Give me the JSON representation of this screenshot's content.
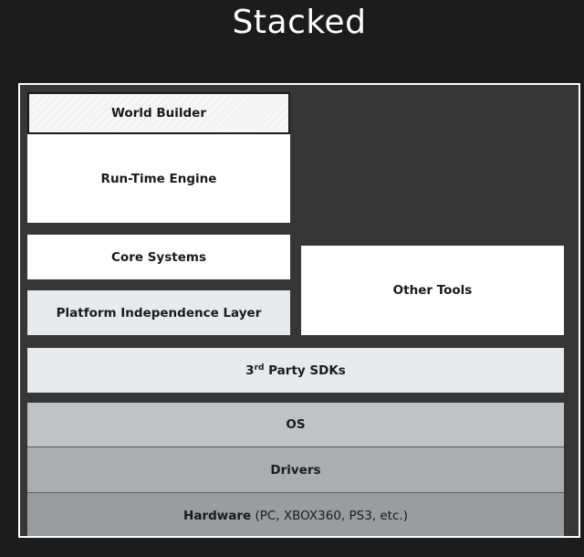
{
  "title": "Stacked",
  "layers": {
    "world_builder": "World Builder",
    "run_time_engine": "Run-Time Engine",
    "core_systems": "Core Systems",
    "platform_independence": "Platform Independence Layer",
    "other_tools": "Other Tools",
    "third_party_sdks": {
      "prefix": "3",
      "superscript": "rd",
      "suffix": " Party SDKs"
    },
    "os": "OS",
    "drivers": "Drivers",
    "hardware": {
      "bold": "Hardware",
      "detail": " (PC, XBOX360, PS3, etc.)"
    }
  },
  "colors": {
    "background": "#1c1c1c",
    "frame_background": "#363636",
    "frame_border": "#ffffff",
    "white_box": "#ffffff",
    "light_box": "#e8e9ea",
    "os_box": "#c1c2c4",
    "drivers_box": "#acadb0",
    "hardware_box": "#9b9c9f"
  }
}
